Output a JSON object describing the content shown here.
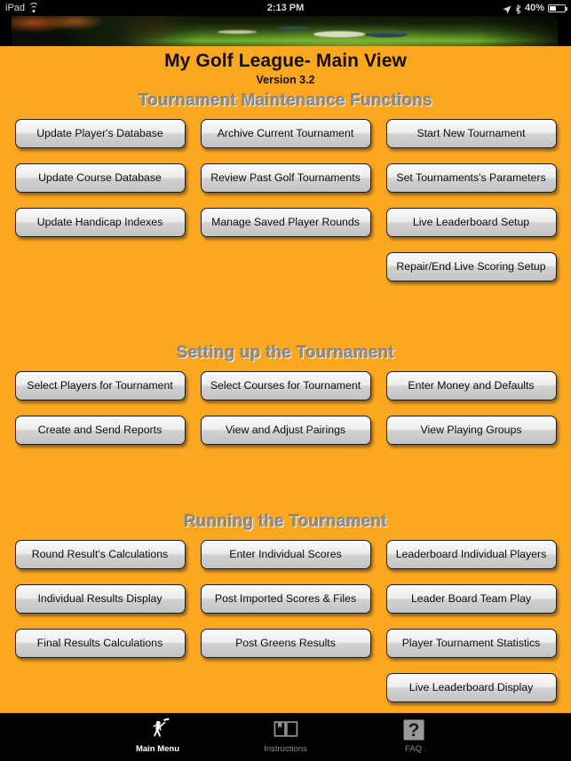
{
  "status_bar": {
    "device": "iPad",
    "wifi_icon": "wifi-icon",
    "time": "2:13 PM",
    "location_icon": "location-arrow-icon",
    "bluetooth_icon": "bluetooth-icon",
    "battery_percent": "40%",
    "battery_icon": "battery-icon"
  },
  "banner": {
    "alt": "golf-course-photo-banner"
  },
  "header": {
    "title": "My Golf League- Main View",
    "version": "Version 3.2"
  },
  "colors": {
    "background_orange": "#FCA720",
    "button_face": "#ECECEC",
    "button_border": "#1C1C1C",
    "section_title": "#8D8D8D",
    "tabbar_background": "#030303",
    "tab_active": "#FFFFFF",
    "tab_inactive": "#8A8A8A"
  },
  "sections": [
    {
      "title": "Tournament Maintenance Functions",
      "rows": [
        [
          "Update Player's Database",
          "Archive Current Tournament",
          "Start New Tournament"
        ],
        [
          "Update Course Database",
          "Review Past Golf Tournaments",
          "Set Tournaments's Parameters"
        ],
        [
          "Update Handicap Indexes",
          "Manage Saved Player Rounds",
          "Live Leaderboard Setup"
        ],
        [
          "",
          "",
          "Repair/End Live Scoring Setup"
        ]
      ]
    },
    {
      "title": "Setting up the Tournament",
      "rows": [
        [
          "Select Players for Tournament",
          "Select Courses for Tournament",
          "Enter Money and Defaults"
        ],
        [
          "Create and Send Reports",
          "View and Adjust Pairings",
          "View Playing Groups"
        ]
      ]
    },
    {
      "title": "Running the Tournament",
      "rows": [
        [
          "Round Result's Calculations",
          "Enter Individual Scores",
          "Leaderboard Individual Players"
        ],
        [
          "Individual Results Display",
          "Post Imported Scores & Files",
          "Leader Board Team Play"
        ],
        [
          "Final Results Calculations",
          "Post Greens Results",
          "Player Tournament Statistics"
        ],
        [
          "",
          "",
          "Live Leaderboard Display"
        ]
      ]
    }
  ],
  "tabbar": {
    "items": [
      {
        "label": "Main Menu",
        "icon": "golfer-swing-icon",
        "active": true
      },
      {
        "label": "Instructions",
        "icon": "open-book-icon",
        "active": false
      },
      {
        "label": "FAQ",
        "icon": "question-mark-icon",
        "active": false
      }
    ]
  }
}
